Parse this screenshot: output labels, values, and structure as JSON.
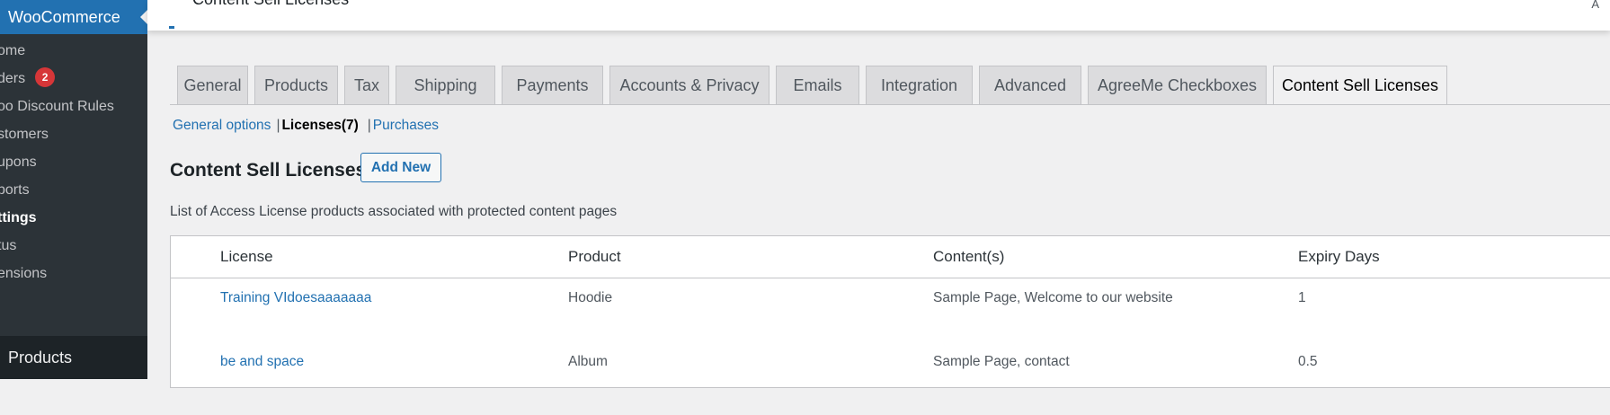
{
  "sidebar": {
    "app_label": "WooCommerce",
    "items": [
      {
        "label": "ome"
      },
      {
        "label": "ders",
        "badge": "2"
      },
      {
        "label": "oo Discount Rules"
      },
      {
        "label": "stomers"
      },
      {
        "label": "upons"
      },
      {
        "label": "ports"
      },
      {
        "label": "ttings",
        "current": true
      },
      {
        "label": "tus"
      },
      {
        "label": "ensions"
      }
    ],
    "products_label": "Products"
  },
  "topbar": {
    "title": "Content Sell Licenses",
    "right_text": "A"
  },
  "tabs": [
    {
      "label": "General"
    },
    {
      "label": "Products"
    },
    {
      "label": "Tax"
    },
    {
      "label": "Shipping"
    },
    {
      "label": "Payments"
    },
    {
      "label": "Accounts & Privacy"
    },
    {
      "label": "Emails"
    },
    {
      "label": "Integration"
    },
    {
      "label": "Advanced"
    },
    {
      "label": "AgreeMe Checkboxes"
    },
    {
      "label": "Content Sell Licenses",
      "active": true
    }
  ],
  "subnav": {
    "general_options": "General options",
    "separator": "|",
    "licenses": "Licenses(7)",
    "purchases": "Purchases"
  },
  "page": {
    "heading": "Content Sell Licenses",
    "add_new_label": "Add New",
    "description": "List of Access License products associated with protected content pages"
  },
  "table": {
    "columns": [
      "License",
      "Product",
      "Content(s)",
      "Expiry Days"
    ],
    "rows": [
      {
        "license": "Training VIdoesaaaaaaa",
        "product": "Hoodie",
        "contents": "Sample Page, Welcome to our website",
        "expiry": "1"
      },
      {
        "license": "be and space",
        "product": "Album",
        "contents": "Sample Page, contact",
        "expiry": "0.5"
      }
    ]
  },
  "colors": {
    "accent": "#2271b1",
    "sidebar_bg": "#1d2327",
    "badge": "#d63638",
    "page_bg": "#f0f0f1"
  }
}
